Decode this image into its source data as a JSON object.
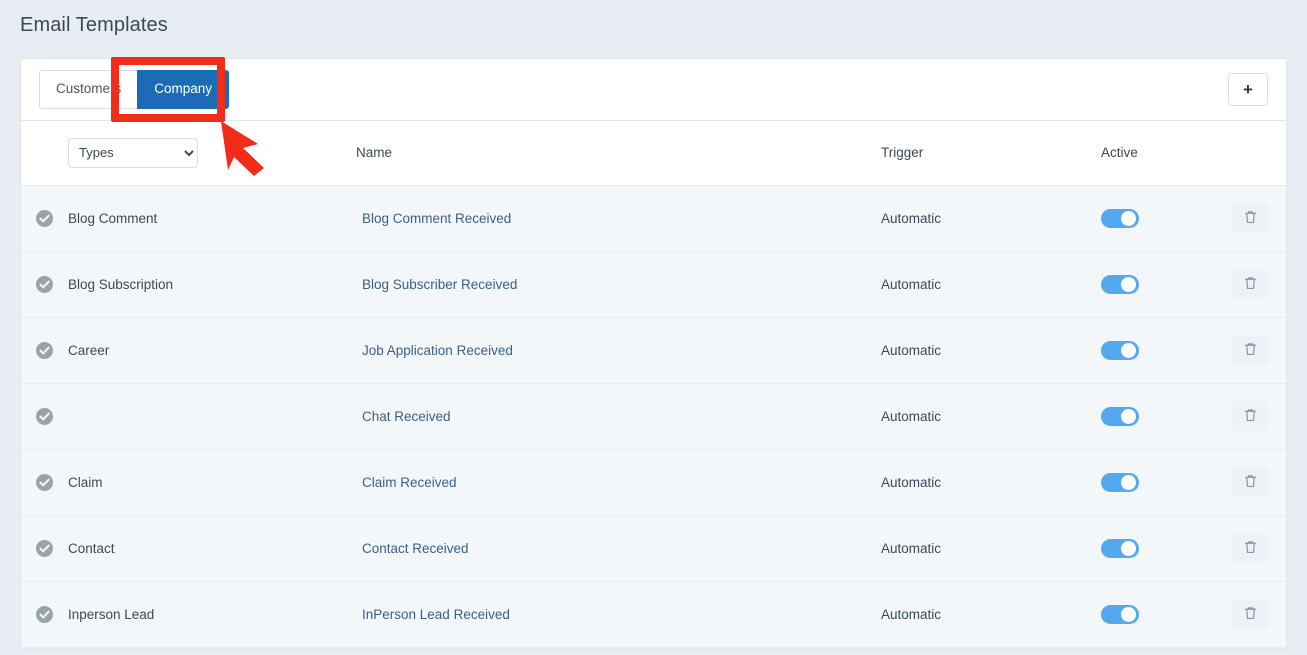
{
  "page": {
    "title": "Email Templates"
  },
  "toolbar": {
    "tabs": [
      {
        "label": "Customers",
        "active": false
      },
      {
        "label": "Company",
        "active": true
      }
    ],
    "add_label": "+"
  },
  "table": {
    "type_filter": {
      "selected": "Types",
      "options": [
        "Types"
      ]
    },
    "headers": {
      "check": "",
      "type": "",
      "name": "Name",
      "trigger": "Trigger",
      "active": "Active",
      "delete": ""
    },
    "rows": [
      {
        "type": "Blog Comment",
        "name": "Blog Comment Received",
        "trigger": "Automatic",
        "active": true,
        "check": "check-circle-icon",
        "delete": "trash-icon"
      },
      {
        "type": "Blog Subscription",
        "name": "Blog Subscriber Received",
        "trigger": "Automatic",
        "active": true,
        "check": "check-circle-icon",
        "delete": "trash-icon"
      },
      {
        "type": "Career",
        "name": "Job Application Received",
        "trigger": "Automatic",
        "active": true,
        "check": "check-circle-icon",
        "delete": "trash-icon"
      },
      {
        "type": "",
        "name": "Chat Received",
        "trigger": "Automatic",
        "active": true,
        "check": "check-circle-icon",
        "delete": "trash-icon"
      },
      {
        "type": "Claim",
        "name": "Claim Received",
        "trigger": "Automatic",
        "active": true,
        "check": "check-circle-icon",
        "delete": "trash-icon"
      },
      {
        "type": "Contact",
        "name": "Contact Received",
        "trigger": "Automatic",
        "active": true,
        "check": "check-circle-icon",
        "delete": "trash-icon"
      },
      {
        "type": "Inperson Lead",
        "name": "InPerson Lead Received",
        "trigger": "Automatic",
        "active": true,
        "check": "check-circle-icon",
        "delete": "trash-icon"
      }
    ]
  },
  "annotations": {
    "highlight_color": "#f22c18",
    "highlight_target": "Company",
    "arrow": "arrow-pointer"
  },
  "colors": {
    "accent": "#1b6cb5",
    "toggle_on": "#53a8f0",
    "link": "#3a5f87",
    "page_bg": "#e8edf4",
    "row_bg": "#f4f7fa"
  }
}
